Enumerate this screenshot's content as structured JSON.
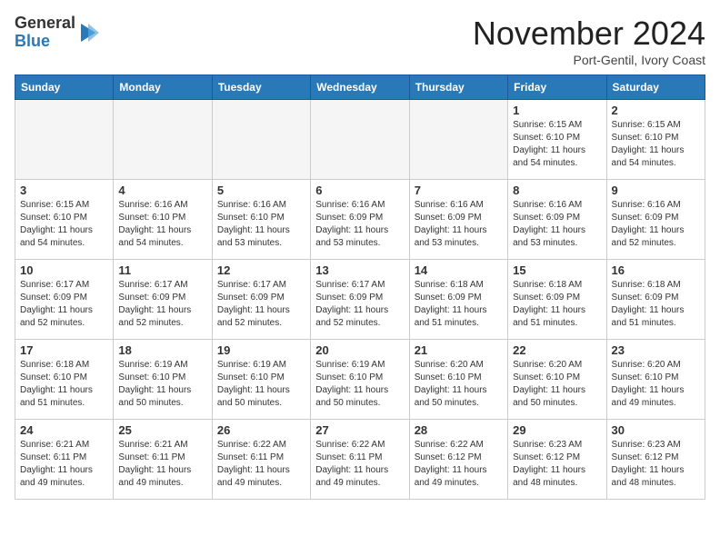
{
  "header": {
    "logo_general": "General",
    "logo_blue": "Blue",
    "month_title": "November 2024",
    "location": "Port-Gentil, Ivory Coast"
  },
  "weekdays": [
    "Sunday",
    "Monday",
    "Tuesday",
    "Wednesday",
    "Thursday",
    "Friday",
    "Saturday"
  ],
  "weeks": [
    [
      {
        "day": "",
        "empty": true,
        "info": ""
      },
      {
        "day": "",
        "empty": true,
        "info": ""
      },
      {
        "day": "",
        "empty": true,
        "info": ""
      },
      {
        "day": "",
        "empty": true,
        "info": ""
      },
      {
        "day": "",
        "empty": true,
        "info": ""
      },
      {
        "day": "1",
        "empty": false,
        "info": "Sunrise: 6:15 AM\nSunset: 6:10 PM\nDaylight: 11 hours and 54 minutes."
      },
      {
        "day": "2",
        "empty": false,
        "info": "Sunrise: 6:15 AM\nSunset: 6:10 PM\nDaylight: 11 hours and 54 minutes."
      }
    ],
    [
      {
        "day": "3",
        "empty": false,
        "info": "Sunrise: 6:15 AM\nSunset: 6:10 PM\nDaylight: 11 hours and 54 minutes."
      },
      {
        "day": "4",
        "empty": false,
        "info": "Sunrise: 6:16 AM\nSunset: 6:10 PM\nDaylight: 11 hours and 54 minutes."
      },
      {
        "day": "5",
        "empty": false,
        "info": "Sunrise: 6:16 AM\nSunset: 6:10 PM\nDaylight: 11 hours and 53 minutes."
      },
      {
        "day": "6",
        "empty": false,
        "info": "Sunrise: 6:16 AM\nSunset: 6:09 PM\nDaylight: 11 hours and 53 minutes."
      },
      {
        "day": "7",
        "empty": false,
        "info": "Sunrise: 6:16 AM\nSunset: 6:09 PM\nDaylight: 11 hours and 53 minutes."
      },
      {
        "day": "8",
        "empty": false,
        "info": "Sunrise: 6:16 AM\nSunset: 6:09 PM\nDaylight: 11 hours and 53 minutes."
      },
      {
        "day": "9",
        "empty": false,
        "info": "Sunrise: 6:16 AM\nSunset: 6:09 PM\nDaylight: 11 hours and 52 minutes."
      }
    ],
    [
      {
        "day": "10",
        "empty": false,
        "info": "Sunrise: 6:17 AM\nSunset: 6:09 PM\nDaylight: 11 hours and 52 minutes."
      },
      {
        "day": "11",
        "empty": false,
        "info": "Sunrise: 6:17 AM\nSunset: 6:09 PM\nDaylight: 11 hours and 52 minutes."
      },
      {
        "day": "12",
        "empty": false,
        "info": "Sunrise: 6:17 AM\nSunset: 6:09 PM\nDaylight: 11 hours and 52 minutes."
      },
      {
        "day": "13",
        "empty": false,
        "info": "Sunrise: 6:17 AM\nSunset: 6:09 PM\nDaylight: 11 hours and 52 minutes."
      },
      {
        "day": "14",
        "empty": false,
        "info": "Sunrise: 6:18 AM\nSunset: 6:09 PM\nDaylight: 11 hours and 51 minutes."
      },
      {
        "day": "15",
        "empty": false,
        "info": "Sunrise: 6:18 AM\nSunset: 6:09 PM\nDaylight: 11 hours and 51 minutes."
      },
      {
        "day": "16",
        "empty": false,
        "info": "Sunrise: 6:18 AM\nSunset: 6:09 PM\nDaylight: 11 hours and 51 minutes."
      }
    ],
    [
      {
        "day": "17",
        "empty": false,
        "info": "Sunrise: 6:18 AM\nSunset: 6:10 PM\nDaylight: 11 hours and 51 minutes."
      },
      {
        "day": "18",
        "empty": false,
        "info": "Sunrise: 6:19 AM\nSunset: 6:10 PM\nDaylight: 11 hours and 50 minutes."
      },
      {
        "day": "19",
        "empty": false,
        "info": "Sunrise: 6:19 AM\nSunset: 6:10 PM\nDaylight: 11 hours and 50 minutes."
      },
      {
        "day": "20",
        "empty": false,
        "info": "Sunrise: 6:19 AM\nSunset: 6:10 PM\nDaylight: 11 hours and 50 minutes."
      },
      {
        "day": "21",
        "empty": false,
        "info": "Sunrise: 6:20 AM\nSunset: 6:10 PM\nDaylight: 11 hours and 50 minutes."
      },
      {
        "day": "22",
        "empty": false,
        "info": "Sunrise: 6:20 AM\nSunset: 6:10 PM\nDaylight: 11 hours and 50 minutes."
      },
      {
        "day": "23",
        "empty": false,
        "info": "Sunrise: 6:20 AM\nSunset: 6:10 PM\nDaylight: 11 hours and 49 minutes."
      }
    ],
    [
      {
        "day": "24",
        "empty": false,
        "info": "Sunrise: 6:21 AM\nSunset: 6:11 PM\nDaylight: 11 hours and 49 minutes."
      },
      {
        "day": "25",
        "empty": false,
        "info": "Sunrise: 6:21 AM\nSunset: 6:11 PM\nDaylight: 11 hours and 49 minutes."
      },
      {
        "day": "26",
        "empty": false,
        "info": "Sunrise: 6:22 AM\nSunset: 6:11 PM\nDaylight: 11 hours and 49 minutes."
      },
      {
        "day": "27",
        "empty": false,
        "info": "Sunrise: 6:22 AM\nSunset: 6:11 PM\nDaylight: 11 hours and 49 minutes."
      },
      {
        "day": "28",
        "empty": false,
        "info": "Sunrise: 6:22 AM\nSunset: 6:12 PM\nDaylight: 11 hours and 49 minutes."
      },
      {
        "day": "29",
        "empty": false,
        "info": "Sunrise: 6:23 AM\nSunset: 6:12 PM\nDaylight: 11 hours and 48 minutes."
      },
      {
        "day": "30",
        "empty": false,
        "info": "Sunrise: 6:23 AM\nSunset: 6:12 PM\nDaylight: 11 hours and 48 minutes."
      }
    ]
  ]
}
